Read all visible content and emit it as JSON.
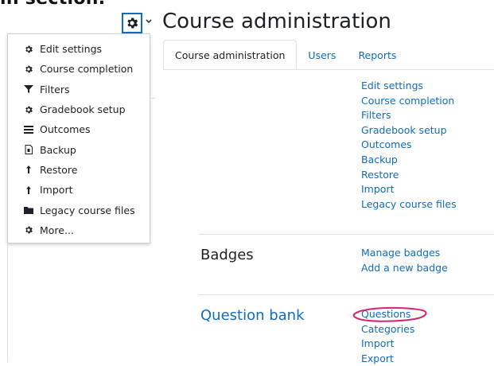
{
  "top_clip_text": "in section.",
  "page_title": "Course administration",
  "menu": {
    "items": [
      {
        "label": "Edit settings",
        "icon": "gear-icon"
      },
      {
        "label": "Course completion",
        "icon": "gear-icon"
      },
      {
        "label": "Filters",
        "icon": "filter-icon"
      },
      {
        "label": "Gradebook setup",
        "icon": "gear-icon"
      },
      {
        "label": "Outcomes",
        "icon": "list-icon"
      },
      {
        "label": "Backup",
        "icon": "file-icon"
      },
      {
        "label": "Restore",
        "icon": "upload-icon"
      },
      {
        "label": "Import",
        "icon": "upload-icon"
      },
      {
        "label": "Legacy course files",
        "icon": "folder-icon"
      },
      {
        "label": "More...",
        "icon": "gear-icon"
      }
    ]
  },
  "tabs": [
    {
      "label": "Course administration",
      "active": true
    },
    {
      "label": "Users",
      "active": false
    },
    {
      "label": "Reports",
      "active": false
    }
  ],
  "course_links": [
    "Edit settings",
    "Course completion",
    "Filters",
    "Gradebook setup",
    "Outcomes",
    "Backup",
    "Restore",
    "Import",
    "Legacy course files"
  ],
  "badges": {
    "title": "Badges",
    "links": [
      "Manage badges",
      "Add a new badge"
    ]
  },
  "question_bank": {
    "title": "Question bank",
    "links": [
      "Questions",
      "Categories",
      "Import",
      "Export"
    ]
  },
  "colors": {
    "link": "#0f6cbf",
    "annotation": "#d6246e",
    "text": "#1d2125"
  }
}
